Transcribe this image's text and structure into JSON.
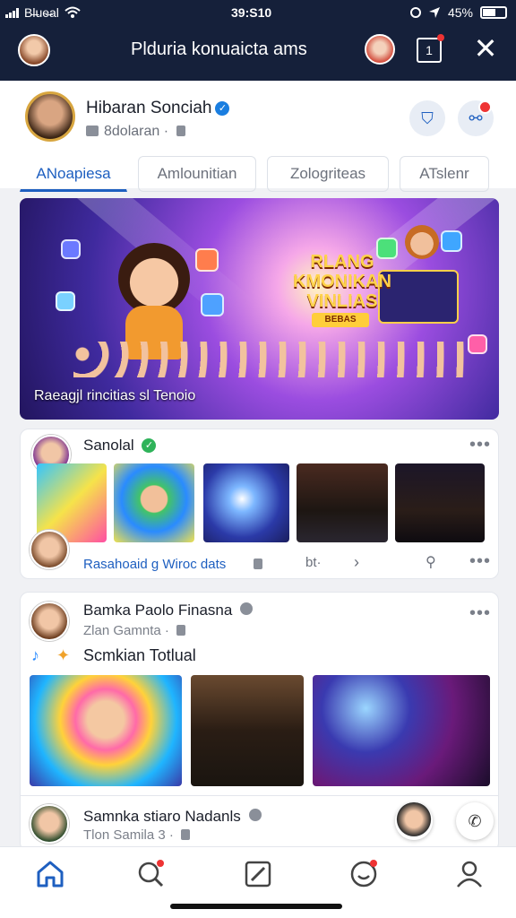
{
  "status": {
    "carrier": "Bl̶ue̶al",
    "time": "39:S10",
    "battery": "45%"
  },
  "appbar": {
    "title": "Plduria konuaicta ams",
    "square_glyph": "1"
  },
  "profile": {
    "name": "Hibaran Sonciah",
    "sub": "8dolaran ·",
    "tabs": [
      {
        "label": "ANoapiesa",
        "active": true
      },
      {
        "label": "Amlounitian",
        "active": false
      },
      {
        "label": "Zologriteas",
        "active": false
      },
      {
        "label": "ATslenr",
        "active": false
      }
    ]
  },
  "hero": {
    "headline": "RLANG KMONIKAN VINLIAS",
    "badge": "BEBAS",
    "caption": "Raeagjl rincitias sl Tenoio"
  },
  "post1": {
    "author": "Sanolal",
    "footer_link": "Rasahoaid g Wiroc dats",
    "footer_meta": "bt·",
    "more": "•••"
  },
  "post2": {
    "author": "Bamka Paolo Finasna",
    "meta": "Zlan Gamnta ·",
    "caption": "Scmkian Totlual",
    "more": "•••"
  },
  "post3": {
    "author": "Samnka stiaro Nadanls",
    "meta": "Tlon Samila 3 ·"
  },
  "colors": {
    "navy": "#15203a",
    "accent": "#1e5fc0",
    "badge_red": "#e33333"
  },
  "icons": [
    "home-icon",
    "search-icon",
    "edit-icon",
    "smile-icon",
    "profile-icon"
  ]
}
